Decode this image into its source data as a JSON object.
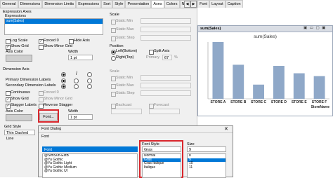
{
  "tabs": [
    "General",
    "Dimensions",
    "Dimension Limits",
    "Expressions",
    "Sort",
    "Style",
    "Presentation",
    "Axes",
    "Colors",
    "Number",
    "Font",
    "Layout",
    "Caption"
  ],
  "active_tab": "Axes",
  "expression_axes": {
    "group_label": "Expression Axes",
    "list_label": "Expressions",
    "items": [
      "sum(Sales)"
    ],
    "log_scale": "Log Scale",
    "forced_0": "Forced 0",
    "hide_axis": "Hide Axis",
    "show_grid": "Show Grid",
    "show_minor_grid": "Show Minor Grid",
    "axis_color": "Axis Color",
    "width_label": "Width",
    "width_value": "1 pt"
  },
  "scale": {
    "label": "Scale",
    "static_min": "Static Min",
    "static_max": "Static Max",
    "static_step": "Static Step"
  },
  "position": {
    "label": "Position",
    "left": "Left(Bottom)",
    "right": "Right(Top)",
    "split_axis": "Split Axis",
    "primary": "Primary",
    "primary_value": "67",
    "percent": "%"
  },
  "dimension_axis": {
    "group_label": "Dimension Axis",
    "primary_labels": "Primary Dimension Labels",
    "secondary_labels": "Secondary Dimension Labels",
    "continuous": "Continuous",
    "forced_0": "Forced 0",
    "show_grid": "Show Grid",
    "show_minor_grid": "Show Minor Grid",
    "stagger_labels": "Stagger Labels",
    "reverse_stagger": "Reverse Stagger",
    "axis_color": "Axis Color",
    "font_button": "Font...",
    "width_label": "Width",
    "width_value": "1 pt",
    "grid_style_label": "Grid Style",
    "grid_style_value": "Thin Dashed Line"
  },
  "scale2": {
    "label": "Scale",
    "static_min": "Static Min",
    "static_max": "Static Max",
    "static_step": "Static Step"
  },
  "backcast": "Backcast",
  "forecast": "Forecast",
  "chart_window": {
    "title": "sum(Sales)"
  },
  "chart_data": {
    "type": "bar",
    "title": "sum(Sales)",
    "xlabel": "StoreName",
    "categories": [
      "STORE A",
      "STORE B",
      "STORE C",
      "STORE D",
      "STORE E",
      "STORE F"
    ],
    "values": [
      100,
      60,
      25,
      58,
      45,
      40
    ],
    "bar_color": "#8fa8c8"
  },
  "font_dialog": {
    "title": "Font Dialog",
    "font_label": "Font",
    "font_value": "Font",
    "fonts": [
      "@SimSun-ExtB",
      "@Yu Gothic",
      "@Yu Gothic Light",
      "@Yu Gothic Medium",
      "@Yu Gothic UI"
    ],
    "style_label": "Font Style",
    "style_value": "Gras",
    "styles": [
      "Normal",
      "Gras",
      "Gras Italique",
      "Italique"
    ],
    "selected_style": "Gras",
    "size_label": "Size",
    "size_value": "9",
    "sizes": [
      "8",
      "9",
      "10",
      "11"
    ],
    "selected_size": "9"
  }
}
